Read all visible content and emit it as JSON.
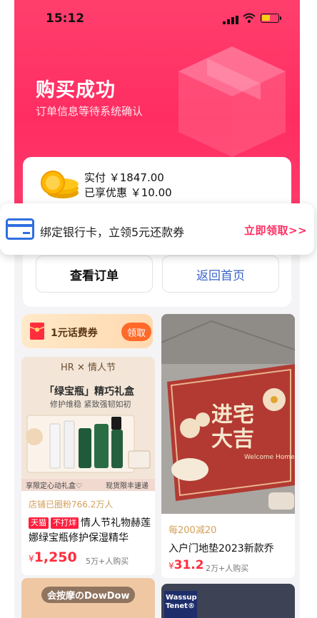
{
  "status_bar": {
    "time": "15:12"
  },
  "hero": {
    "title": "购买成功",
    "subtitle": "订单信息等待系统确认"
  },
  "order_card": {
    "paid": "实付 ￥1847.00",
    "discount": "已享优惠 ￥10.00",
    "view_order_label": "查看订单",
    "back_home_label": "返回首页"
  },
  "banner": {
    "text": "绑定银行卡，立领5元还款券",
    "cta": "立即领取>>"
  },
  "coupon": {
    "text": "1元话费券",
    "button": "领取"
  },
  "product1": {
    "image_header": "HR ✕ 情人节",
    "image_title": "「绿宝瓶」精巧礼盒",
    "image_sub": "修护维稳 紧致强韧如初",
    "image_strip_left": "享限定心动礼盒♡",
    "image_strip_right": "现货限丰速递",
    "shop_fans": "店铺已圈粉766.2万人",
    "tag1": "天猫",
    "tag2": "不打烊",
    "title": "情人节礼物赫莲娜绿宝瓶修护保湿精华",
    "yen": "¥",
    "price": "1,250",
    "sold": "5万+人购买"
  },
  "product2": {
    "image_text": "进宅大吉",
    "image_small": "Welcome Home",
    "promo": "每200减20",
    "title": "入户门地垫2023新款乔",
    "yen": "¥",
    "price": "31.2",
    "sold": "2万+人购买"
  },
  "product3": {
    "image_label": "会按摩のDowDow"
  },
  "product4": {
    "image_label": "Wassup Tenet®"
  },
  "colors": {
    "brand": "#ff2d62",
    "price": "#ff2d3d",
    "link": "#3a63c9"
  }
}
